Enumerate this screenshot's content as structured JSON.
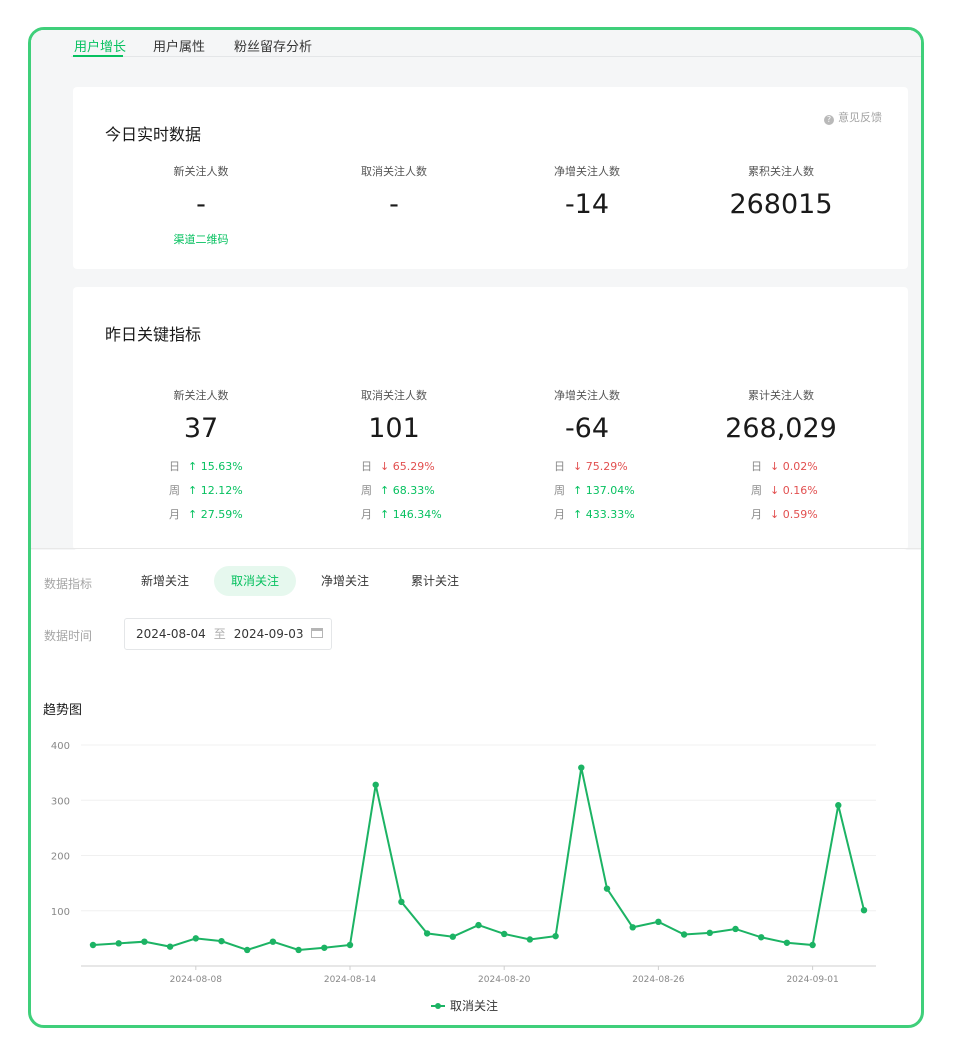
{
  "tabs": [
    "用户增长",
    "用户属性",
    "粉丝留存分析"
  ],
  "realtime": {
    "title": "今日实时数据",
    "feedback": "意见反馈",
    "metrics": [
      {
        "label": "新关注人数",
        "value": "-",
        "link": "渠道二维码"
      },
      {
        "label": "取消关注人数",
        "value": "-"
      },
      {
        "label": "净增关注人数",
        "value": "-14"
      },
      {
        "label": "累积关注人数",
        "value": "268015"
      }
    ]
  },
  "yesterday": {
    "title": "昨日关键指标",
    "metrics": [
      {
        "label": "新关注人数",
        "value": "37",
        "changes": [
          {
            "period": "日",
            "dir": "up",
            "value": "15.63%"
          },
          {
            "period": "周",
            "dir": "up",
            "value": "12.12%"
          },
          {
            "period": "月",
            "dir": "up",
            "value": "27.59%"
          }
        ]
      },
      {
        "label": "取消关注人数",
        "value": "101",
        "changes": [
          {
            "period": "日",
            "dir": "down",
            "value": "65.29%"
          },
          {
            "period": "周",
            "dir": "up",
            "value": "68.33%"
          },
          {
            "period": "月",
            "dir": "up",
            "value": "146.34%"
          }
        ]
      },
      {
        "label": "净增关注人数",
        "value": "-64",
        "changes": [
          {
            "period": "日",
            "dir": "down",
            "value": "75.29%"
          },
          {
            "period": "周",
            "dir": "up",
            "value": "137.04%"
          },
          {
            "period": "月",
            "dir": "up",
            "value": "433.33%"
          }
        ]
      },
      {
        "label": "累计关注人数",
        "value": "268,029",
        "changes": [
          {
            "period": "日",
            "dir": "down",
            "value": "0.02%"
          },
          {
            "period": "周",
            "dir": "down",
            "value": "0.16%"
          },
          {
            "period": "月",
            "dir": "down",
            "value": "0.59%"
          }
        ]
      }
    ]
  },
  "filters": {
    "metric_label": "数据指标",
    "metric_options": [
      "新增关注",
      "取消关注",
      "净增关注",
      "累计关注"
    ],
    "selected_metric": "取消关注",
    "time_label": "数据时间",
    "date_start": "2024-08-04",
    "date_sep": "至",
    "date_end": "2024-09-03"
  },
  "arrows": {
    "up": "↑",
    "down": "↓"
  },
  "colors": {
    "accent": "#07c160",
    "down": "#e25050",
    "frame": "#3fcf7a"
  },
  "chart_data": {
    "type": "line",
    "title": "趋势图",
    "legend_position": "bottom-center",
    "grid": true,
    "ylim": [
      0,
      400
    ],
    "yticks": [
      100,
      200,
      300,
      400
    ],
    "xtick_labels": [
      "2024-08-08",
      "2024-08-14",
      "2024-08-20",
      "2024-08-26",
      "2024-09-01"
    ],
    "x": [
      "2024-08-04",
      "2024-08-05",
      "2024-08-06",
      "2024-08-07",
      "2024-08-08",
      "2024-08-09",
      "2024-08-10",
      "2024-08-11",
      "2024-08-12",
      "2024-08-13",
      "2024-08-14",
      "2024-08-15",
      "2024-08-16",
      "2024-08-17",
      "2024-08-18",
      "2024-08-19",
      "2024-08-20",
      "2024-08-21",
      "2024-08-22",
      "2024-08-23",
      "2024-08-24",
      "2024-08-25",
      "2024-08-26",
      "2024-08-27",
      "2024-08-28",
      "2024-08-29",
      "2024-08-30",
      "2024-08-31",
      "2024-09-01",
      "2024-09-02",
      "2024-09-03"
    ],
    "series": [
      {
        "name": "取消关注",
        "color": "#1cb364",
        "values": [
          38,
          41,
          44,
          35,
          50,
          45,
          29,
          44,
          29,
          33,
          38,
          328,
          116,
          59,
          53,
          74,
          58,
          48,
          54,
          359,
          140,
          70,
          80,
          57,
          60,
          67,
          52,
          42,
          38,
          291,
          101
        ]
      }
    ]
  }
}
